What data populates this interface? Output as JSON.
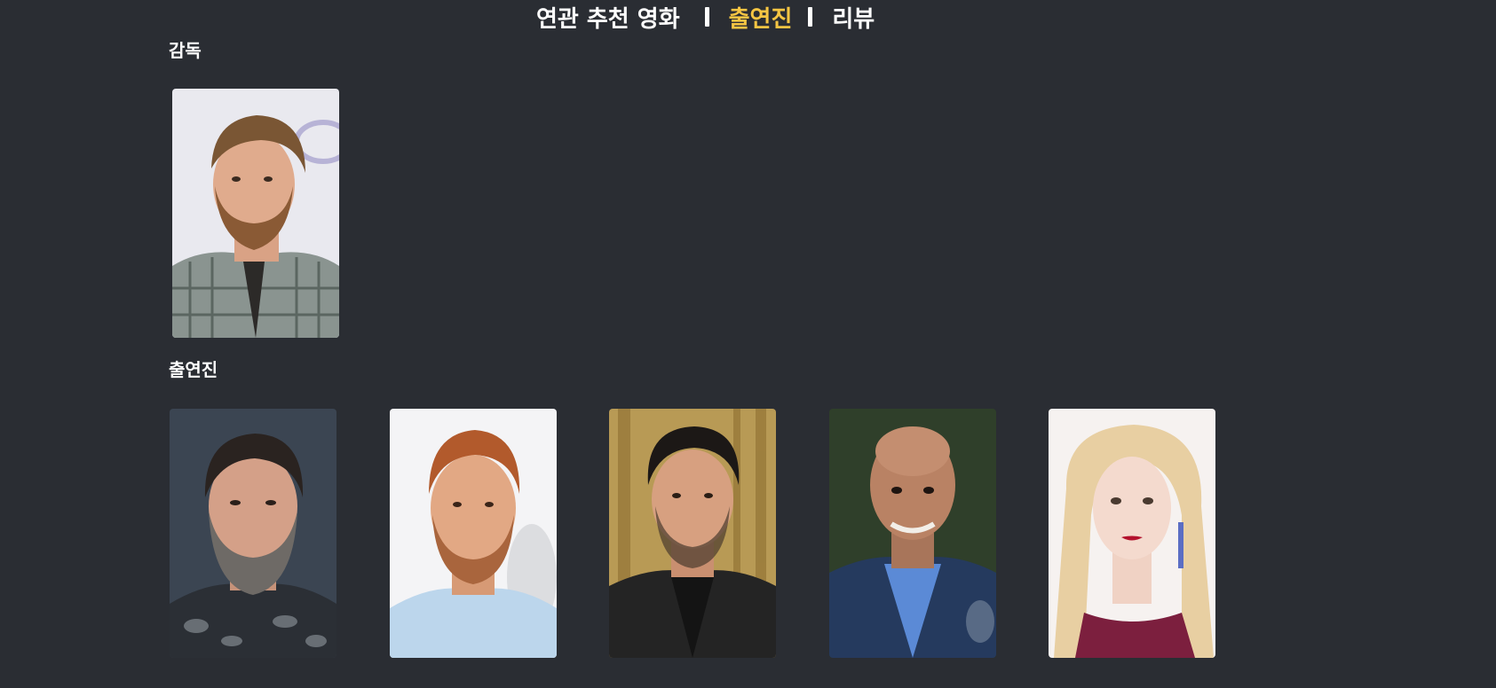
{
  "tabs": {
    "related": "연관 추천 영화",
    "cast": "출연진",
    "reviews": "리뷰",
    "active_color": "#f6c543"
  },
  "sections": {
    "director": "감독",
    "cast": "출연진"
  },
  "colors": {
    "background": "#2a2d33",
    "text": "#ffffff"
  }
}
